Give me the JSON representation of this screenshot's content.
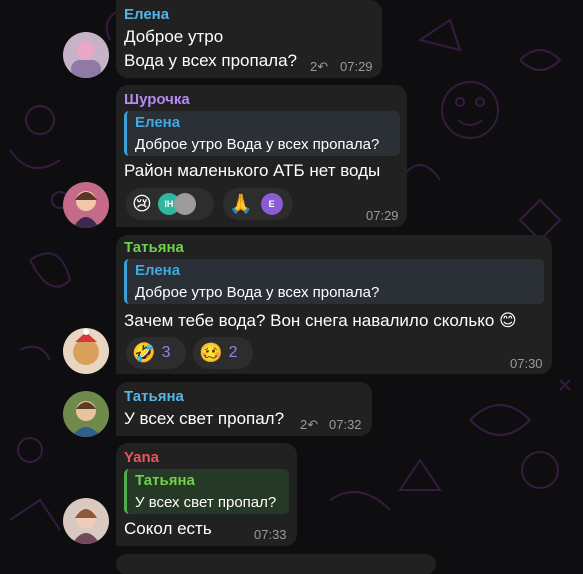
{
  "messages": [
    {
      "sender": "Елена",
      "sender_color": "#56b5e6",
      "lines": [
        "Доброе утро",
        "Вода у всех пропала?"
      ],
      "forwards": "2",
      "time": "07:29"
    },
    {
      "sender": "Шурочка",
      "sender_color": "#b689f0",
      "reply_name": "Елена",
      "reply_text": "Доброе утро Вода у всех пропала?",
      "text": "Район маленького АТБ нет воды",
      "reactions": [
        {
          "emoji": "😢",
          "users": [
            "IH",
            ""
          ]
        },
        {
          "emoji": "🙏",
          "users": [
            "E"
          ]
        }
      ],
      "time": "07:29"
    },
    {
      "sender": "Татьяна",
      "sender_color": "#6fd24a",
      "reply_name": "Елена",
      "reply_text": "Доброе утро Вода у всех пропала?",
      "text": "Зачем тебе вода? Вон снега навалило сколько 😊",
      "reactions": [
        {
          "emoji": "🤣",
          "count": "3"
        },
        {
          "emoji": "🥴",
          "count": "2"
        }
      ],
      "time": "07:30"
    },
    {
      "sender": "Татьяна",
      "sender_color": "#56b5e6",
      "text": "У всех свет пропал?",
      "forwards": "2",
      "time": "07:32"
    },
    {
      "sender": "Yana",
      "sender_color": "#e8575a",
      "reply_name": "Татьяна",
      "reply_text": "У всех свет пропал?",
      "text": "Сокол есть",
      "time": "07:33"
    }
  ],
  "icons": {
    "forward": "share-arrow-icon"
  },
  "colors": {
    "background": "#0e0e10",
    "bubble": "#212121",
    "reaction_count": "#a07ce8",
    "doodle": "#3a1d46"
  }
}
